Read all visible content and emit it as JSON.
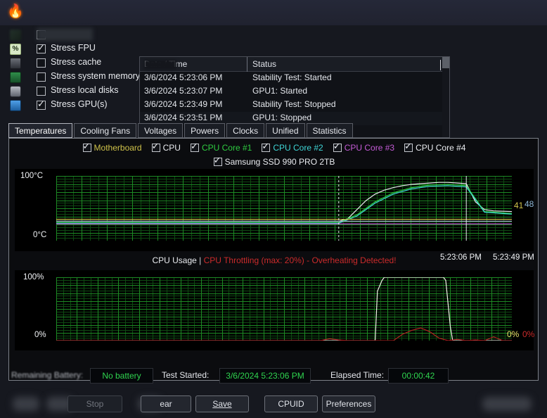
{
  "titlebar": {
    "icon": "flame-icon",
    "title": ""
  },
  "stress_options": [
    {
      "label": "",
      "checked": false,
      "icon": "blurred-icon",
      "obscured": true
    },
    {
      "label": "Stress FPU",
      "checked": true,
      "icon": "fpu-icon",
      "obscured": false
    },
    {
      "label": "Stress cache",
      "checked": false,
      "icon": "cache-icon",
      "obscured": false
    },
    {
      "label": "Stress system memory",
      "checked": false,
      "icon": "memory-icon",
      "obscured": false
    },
    {
      "label": "Stress local disks",
      "checked": false,
      "icon": "disk-icon",
      "obscured": false
    },
    {
      "label": "Stress GPU(s)",
      "checked": true,
      "icon": "gpu-icon",
      "obscured": false
    }
  ],
  "log": {
    "columns": [
      "Date / Time",
      "Status"
    ],
    "rows": [
      {
        "datetime": "3/6/2024 5:23:06 PM",
        "status": "Stability Test: Started"
      },
      {
        "datetime": "3/6/2024 5:23:07 PM",
        "status": "GPU1: Started"
      },
      {
        "datetime": "3/6/2024 5:23:49 PM",
        "status": "Stability Test: Stopped"
      },
      {
        "datetime": "3/6/2024 5:23:51 PM",
        "status": "GPU1: Stopped"
      }
    ]
  },
  "tabs": [
    {
      "label": "Temperatures",
      "active": true
    },
    {
      "label": "Cooling Fans",
      "active": false
    },
    {
      "label": "Voltages",
      "active": false
    },
    {
      "label": "Powers",
      "active": false
    },
    {
      "label": "Clocks",
      "active": false
    },
    {
      "label": "Unified",
      "active": false
    },
    {
      "label": "Statistics",
      "active": false
    }
  ],
  "sensor_legend_row1": [
    {
      "label": "Motherboard",
      "color": "#cfc24a",
      "checked": true
    },
    {
      "label": "CPU",
      "color": "#e9ebef",
      "checked": true
    },
    {
      "label": "CPU Core #1",
      "color": "#2ecc40",
      "checked": true
    },
    {
      "label": "CPU Core #2",
      "color": "#3fd6d6",
      "checked": true
    },
    {
      "label": "CPU Core #3",
      "color": "#c45bd6",
      "checked": true
    },
    {
      "label": "CPU Core #4",
      "color": "#e9ebef",
      "checked": true
    }
  ],
  "sensor_legend_row2": [
    {
      "label": "Samsung SSD 990 PRO 2TB",
      "color": "#e9ebef",
      "checked": true
    }
  ],
  "usage_title": {
    "main": "CPU Usage",
    "separator": "|",
    "warning": "CPU Throttling (max: 20%) - Overheating Detected!"
  },
  "status_bar": {
    "battery_label": "Remaining Battery:",
    "battery_value": "No battery",
    "test_started_label": "Test Started:",
    "test_started_value": "3/6/2024 5:23:06 PM",
    "elapsed_label": "Elapsed Time:",
    "elapsed_value": "00:00:42"
  },
  "buttons": [
    {
      "label": "",
      "name": "obscured-button-1",
      "blurred": true
    },
    {
      "label": "",
      "name": "obscured-button-2",
      "blurred": true
    },
    {
      "label": "Stop",
      "name": "stop-button",
      "disabled": true
    },
    {
      "label": "",
      "name": "obscured-button-3",
      "blurred": true
    },
    {
      "label": "ear",
      "name": "clear-button",
      "disabled": false
    },
    {
      "label": "Save",
      "name": "save-button",
      "disabled": false
    },
    {
      "label": "CPUID",
      "name": "cpuid-button",
      "disabled": false
    },
    {
      "label": "Preferences",
      "name": "preferences-button",
      "disabled": false
    },
    {
      "label": "",
      "name": "obscured-button-4",
      "blurred": true
    }
  ],
  "chart_data": [
    {
      "type": "line",
      "name": "temperatures",
      "title": "Temperatures",
      "ylabel_top": "100°C",
      "ylabel_bottom": "0°C",
      "ylim": [
        0,
        100
      ],
      "xlabels": [
        "5:23:06 PM",
        "5:23:49 PM"
      ],
      "grid": true,
      "grid_color": "#1d8a24",
      "value_labels": [
        {
          "text": "41",
          "color": "#cfc24a"
        },
        {
          "text": "48",
          "color": "#8fb8d8"
        }
      ],
      "series": [
        {
          "name": "CPU",
          "color": "#e9ebef",
          "x": [
            0,
            62,
            64,
            66,
            68,
            70,
            72,
            74,
            76,
            78,
            80,
            82,
            84,
            86,
            88,
            90,
            92,
            94,
            96,
            100
          ],
          "y": [
            30,
            30,
            34,
            48,
            62,
            72,
            78,
            82,
            85,
            87,
            88,
            89,
            90,
            90,
            89,
            88,
            60,
            48,
            46,
            45
          ]
        },
        {
          "name": "CPU Core #1",
          "color": "#2ecc40",
          "x": [
            0,
            62,
            66,
            70,
            74,
            78,
            82,
            86,
            90,
            94,
            100
          ],
          "y": [
            28,
            28,
            40,
            60,
            74,
            82,
            86,
            87,
            85,
            45,
            42
          ]
        },
        {
          "name": "CPU Core #2",
          "color": "#3fd6d6",
          "x": [
            0,
            62,
            66,
            70,
            74,
            78,
            82,
            86,
            90,
            94,
            100
          ],
          "y": [
            27,
            27,
            38,
            58,
            72,
            80,
            84,
            85,
            83,
            44,
            41
          ]
        },
        {
          "name": "Motherboard",
          "color": "#cfc24a",
          "x": [
            0,
            100
          ],
          "y": [
            33,
            33
          ]
        },
        {
          "name": "CPU Core #3",
          "color": "#c45bd6",
          "x": [
            0,
            100
          ],
          "y": [
            26,
            26
          ]
        },
        {
          "name": "Samsung SSD 990 PRO 2TB",
          "color": "#9fb4c9",
          "x": [
            0,
            100
          ],
          "y": [
            30,
            30
          ]
        }
      ]
    },
    {
      "type": "line",
      "name": "cpu_usage",
      "title": "CPU Usage",
      "ylabel_top": "100%",
      "ylabel_bottom": "0%",
      "ylim": [
        0,
        100
      ],
      "grid": true,
      "grid_color": "#1d8a24",
      "value_labels": [
        {
          "text": "0%",
          "color": "#e9e26a"
        },
        {
          "text": "0%",
          "color": "#cc2b2b"
        }
      ],
      "series": [
        {
          "name": "CPU Usage",
          "color": "#f2f4e8",
          "x": [
            0,
            70,
            70.5,
            71.5,
            72,
            85,
            85.5,
            86.5,
            87,
            100
          ],
          "y": [
            0,
            0,
            78,
            95,
            100,
            100,
            95,
            22,
            0,
            0
          ]
        },
        {
          "name": "CPU Throttling",
          "color": "#b02020",
          "x": [
            0,
            58,
            60,
            62,
            64,
            74,
            76,
            78,
            80,
            82,
            84,
            86,
            88,
            90,
            92,
            94,
            96,
            98,
            100
          ],
          "y": [
            0,
            0,
            3,
            1,
            0,
            0,
            10,
            16,
            20,
            14,
            4,
            0,
            2,
            0,
            1,
            0,
            6,
            0,
            0
          ]
        }
      ]
    }
  ]
}
